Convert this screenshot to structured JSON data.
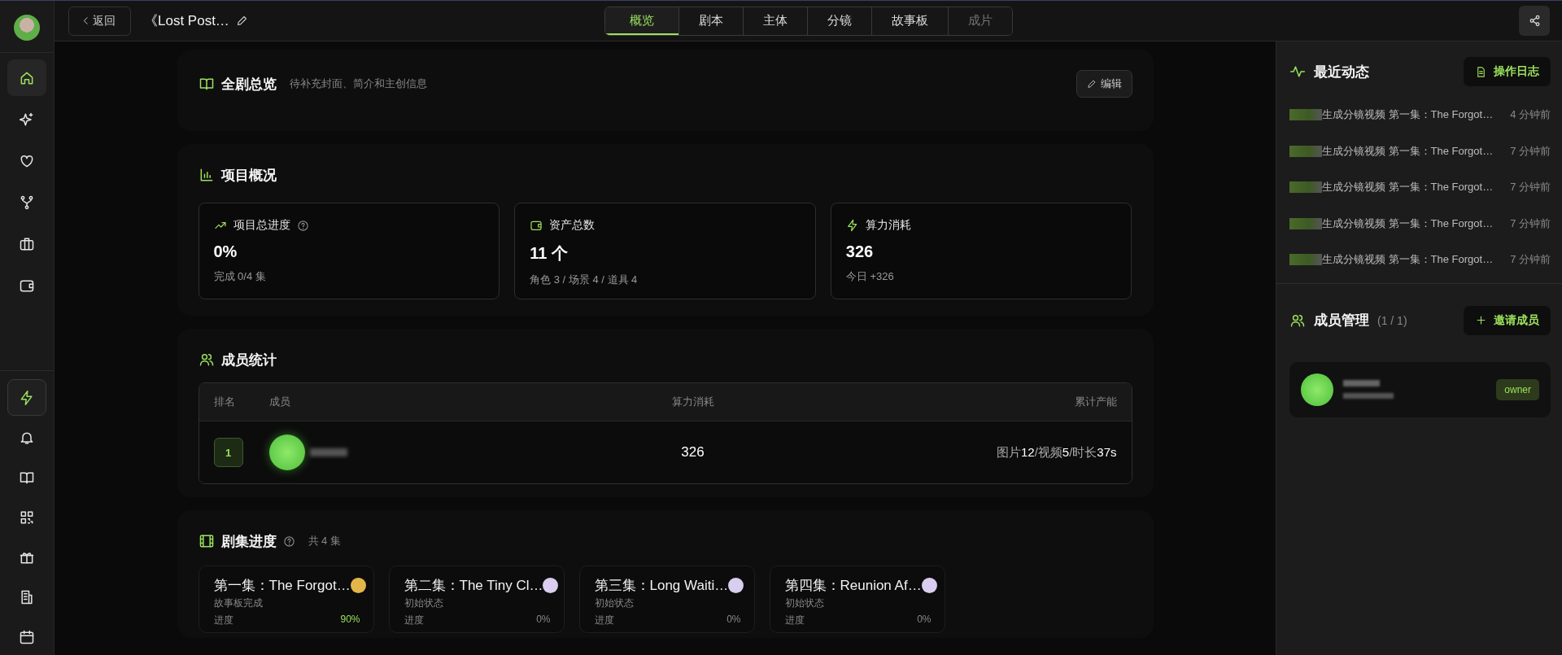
{
  "sidebar": {
    "items": [
      {
        "kind": "home",
        "selected": true
      },
      {
        "kind": "sparkle",
        "selected": false
      },
      {
        "kind": "heart",
        "selected": false
      },
      {
        "kind": "fork",
        "selected": false
      },
      {
        "kind": "briefcase",
        "selected": false
      },
      {
        "kind": "wallet",
        "selected": false
      }
    ],
    "bottom_items": [
      {
        "kind": "bolt",
        "selected": true
      },
      {
        "kind": "bell",
        "selected": false
      },
      {
        "kind": "book",
        "selected": false
      },
      {
        "kind": "qr",
        "selected": false
      },
      {
        "kind": "gift",
        "selected": false
      },
      {
        "kind": "building",
        "selected": false
      },
      {
        "kind": "calendar",
        "selected": false
      }
    ]
  },
  "top_bar": {
    "back": "返回",
    "title": "《Lost Post…",
    "tabs": [
      {
        "label": "概览",
        "selected": true,
        "disabled": false
      },
      {
        "label": "剧本",
        "selected": false,
        "disabled": false
      },
      {
        "label": "主体",
        "selected": false,
        "disabled": false
      },
      {
        "label": "分镜",
        "selected": false,
        "disabled": false
      },
      {
        "label": "故事板",
        "selected": false,
        "disabled": false
      },
      {
        "label": "成片",
        "selected": false,
        "disabled": true
      }
    ]
  },
  "overview": {
    "title": "全剧总览",
    "hint": "待补充封面、简介和主创信息",
    "edit": "编辑"
  },
  "project": {
    "title": "项目概况",
    "stats": [
      {
        "kind": "trend",
        "label": "项目总进度",
        "help": true,
        "value": "0%",
        "sub": "完成 0/4 集"
      },
      {
        "kind": "wallet",
        "label": "资产总数",
        "help": false,
        "value": "11 个",
        "sub": "角色 3 / 场景 4 / 道具 4"
      },
      {
        "kind": "bolt",
        "label": "算力消耗",
        "help": false,
        "value": "326",
        "sub": "今日 +326"
      }
    ]
  },
  "members": {
    "title": "成员统计",
    "columns": [
      "排名",
      "成员",
      "算力消耗",
      "累计产能"
    ],
    "rows": [
      {
        "rank": "1",
        "compute": "326",
        "output": [
          {
            "label": "图片",
            "value": "12"
          },
          {
            "label": "/视频",
            "value": "5"
          },
          {
            "label": "/时长",
            "value": "37s"
          }
        ]
      }
    ]
  },
  "episodes": {
    "title": "剧集进度",
    "count": "共 4 集",
    "items": [
      {
        "title": "第一集：The Forgot…",
        "status": "故事板完成",
        "color": "#e3b64a",
        "progress_label": "进度",
        "percent": "90%",
        "highlighted": true
      },
      {
        "title": "第二集：The Tiny Cl…",
        "status": "初始状态",
        "color": "#d9cdf0",
        "progress_label": "进度",
        "percent": "0%",
        "highlighted": false
      },
      {
        "title": "第三集：Long Waiti…",
        "status": "初始状态",
        "color": "#d9cdf0",
        "progress_label": "进度",
        "percent": "0%",
        "highlighted": false
      },
      {
        "title": "第四集：Reunion Af…",
        "status": "初始状态",
        "color": "#d9cdf0",
        "progress_label": "进度",
        "percent": "0%",
        "highlighted": false
      }
    ]
  },
  "activity": {
    "title": "最近动态",
    "button": "操作日志",
    "items": [
      {
        "text": "生成分镜视频 第一集：The Forgot…",
        "time": "4 分钟前"
      },
      {
        "text": "生成分镜视频 第一集：The Forgot…",
        "time": "7 分钟前"
      },
      {
        "text": "生成分镜视频 第一集：The Forgot…",
        "time": "7 分钟前"
      },
      {
        "text": "生成分镜视频 第一集：The Forgot…",
        "time": "7 分钟前"
      },
      {
        "text": "生成分镜视频 第一集：The Forgot…",
        "time": "7 分钟前"
      }
    ]
  },
  "team": {
    "title": "成员管理",
    "count": "(1 / 1)",
    "button": "邀请成员",
    "members": [
      {
        "role": "owner"
      }
    ]
  }
}
